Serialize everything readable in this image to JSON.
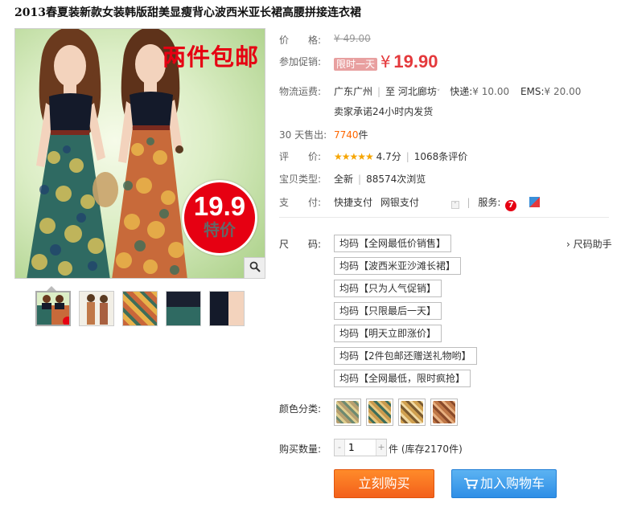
{
  "product": {
    "title": "2013春夏装新款女装韩版甜美显瘦背心波西米亚长裙高腰拼接连衣裙"
  },
  "image": {
    "promo_text": "两件包邮",
    "badge_price": "19.9",
    "badge_label": "特价",
    "zoom_icon": "magnifier-icon"
  },
  "thumbnails": [
    {
      "name": "thumb-1-models"
    },
    {
      "name": "thumb-2-models"
    },
    {
      "name": "thumb-3-fabric"
    },
    {
      "name": "thumb-4-detail"
    },
    {
      "name": "thumb-5-detail"
    }
  ],
  "price": {
    "label": "价　　格:",
    "original": "¥ 49.00"
  },
  "promo": {
    "label": "参加促销:",
    "tag": "限时一天",
    "currency": "¥",
    "price": "19.90"
  },
  "shipping": {
    "label": "物流运费:",
    "from": "广东广州",
    "to_prefix": "至",
    "to": "河北廊坊",
    "express_label": "快递:",
    "express_price": "¥ 10.00",
    "ems_label": "EMS:",
    "ems_price": "¥ 20.00",
    "promise": "卖家承诺24小时内发货"
  },
  "sales": {
    "label": "30 天售出:",
    "count": "7740",
    "unit": "件"
  },
  "rating": {
    "label": "评　　价:",
    "stars": "★★★★★",
    "score": "4.7分",
    "reviews": "1068条评价"
  },
  "category": {
    "label": "宝贝类型:",
    "condition": "全新",
    "views": "88574次浏览"
  },
  "payment": {
    "label": "支　　付:",
    "method1": "快捷支付",
    "method2": "网银支付",
    "service_label": "服务:"
  },
  "size": {
    "label": "尺　　码:",
    "help": "› 尺码助手",
    "options": [
      "均码【全网最低价销售】",
      "均码【波西米亚沙滩长裙】",
      "均码【只为人气促销】",
      "均码【只限最后一天】",
      "均码【明天立即涨价】",
      "均码【2件包邮还赠送礼物哟】",
      "均码【全网最低，限时疯抢】"
    ]
  },
  "color": {
    "label": "颜色分类:",
    "swatches": [
      "#b8a070",
      "#c99a4e",
      "#d0a050",
      "#c07848"
    ]
  },
  "quantity": {
    "label": "购买数量:",
    "minus": "-",
    "value": "1",
    "plus": "+",
    "unit": "件",
    "stock": "(库存2170件)"
  },
  "actions": {
    "buy_now": "立刻购买",
    "add_cart": "加入购物车"
  }
}
